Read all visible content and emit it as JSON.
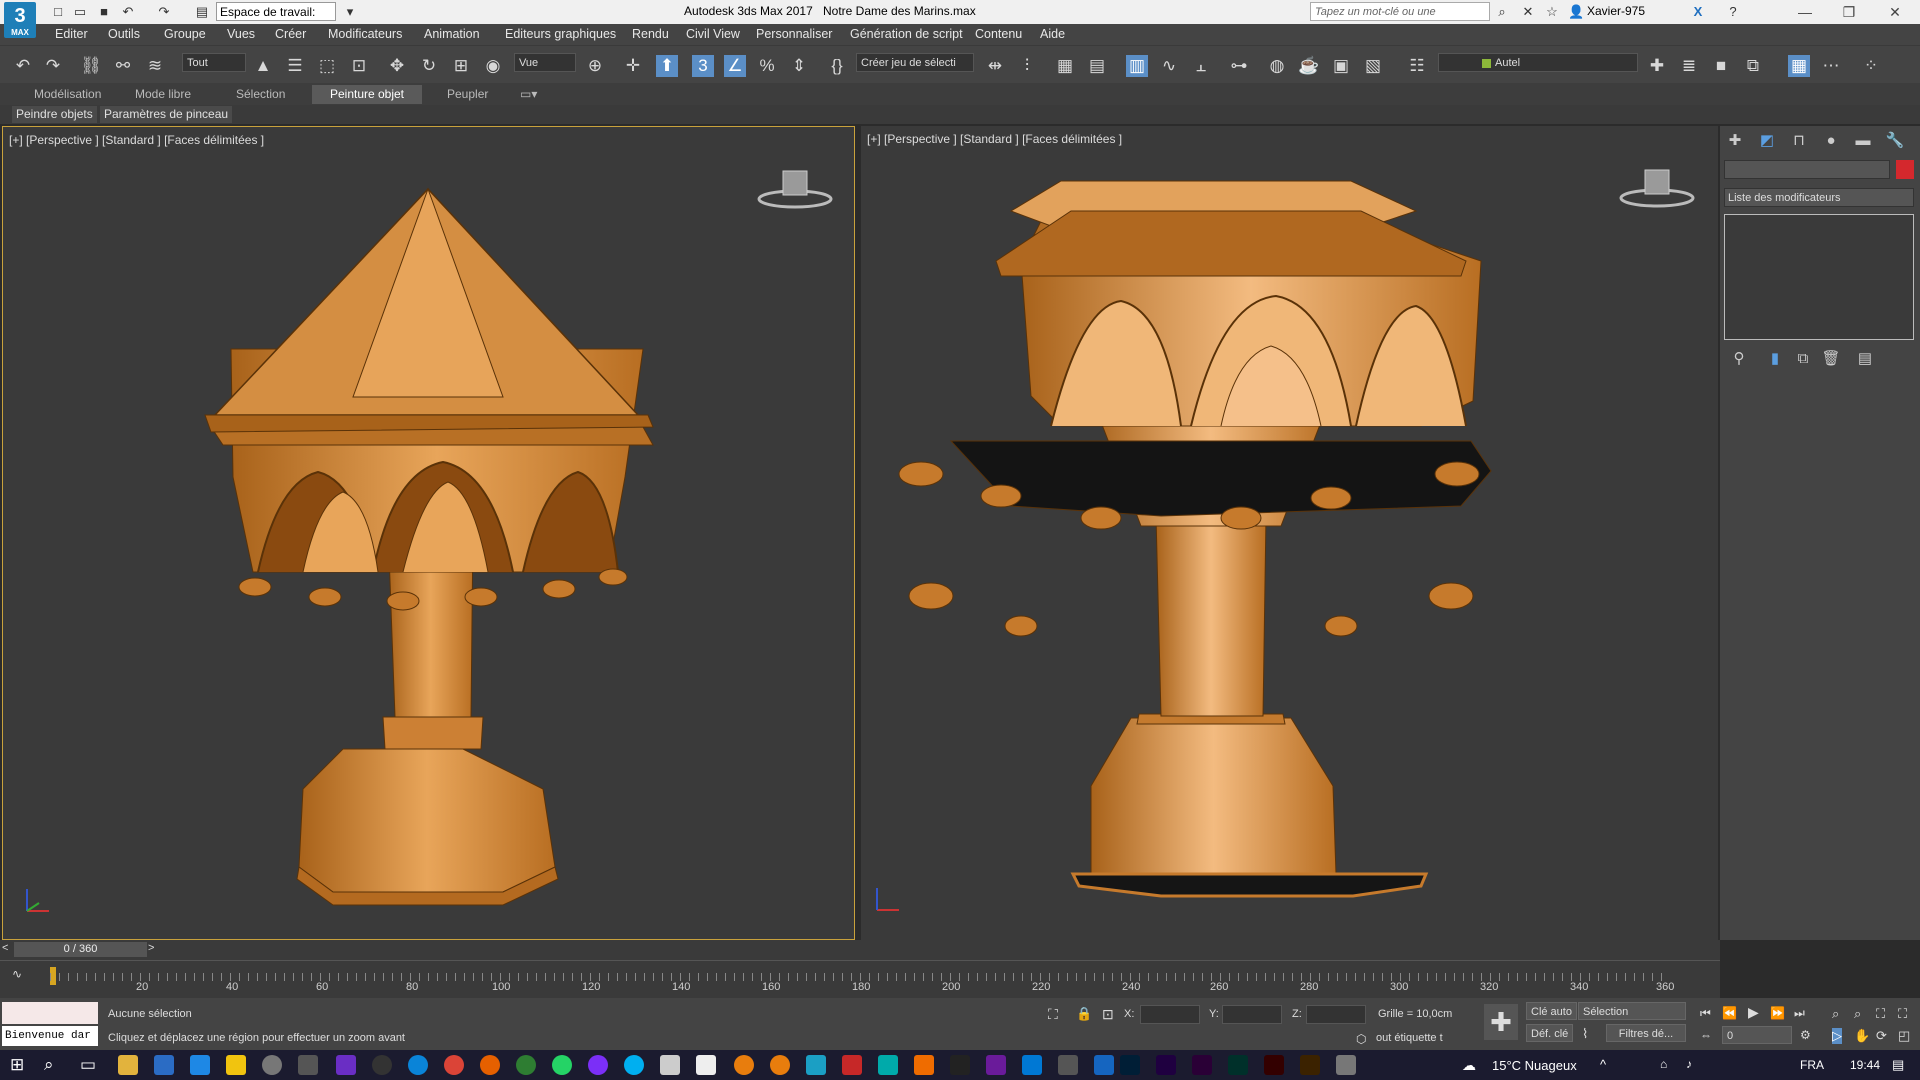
{
  "titlebar": {
    "logo_text": "3",
    "logo_sub": "MAX",
    "workspace": "Espace de travail: Par",
    "app_title": "Autodesk 3ds Max 2017",
    "doc_title": "Notre Dame des Marins.max",
    "search_placeholder": "Tapez un mot-clé ou une expression",
    "user": "Xavier-975"
  },
  "menu": [
    "Editer",
    "Outils",
    "Groupe",
    "Vues",
    "Créer",
    "Modificateurs",
    "Animation",
    "Editeurs graphiques",
    "Rendu",
    "Civil View",
    "Personnaliser",
    "Génération de script",
    "Contenu",
    "Aide"
  ],
  "toolbar": {
    "filter": "Tout",
    "ref_coord": "Vue",
    "selection_set": "Créer jeu de sélecti",
    "layer": "Autel"
  },
  "ribbon": {
    "tabs": [
      "Modélisation",
      "Mode libre",
      "Sélection",
      "Peinture objet",
      "Peupler"
    ],
    "active_tab": "Peinture objet",
    "sub": [
      "Peindre objets",
      "Paramètres de pinceau"
    ]
  },
  "viewports": [
    {
      "label": "[+] [Perspective ] [Standard ] [Faces délimitées ]"
    },
    {
      "label": "[+] [Perspective ] [Standard ] [Faces délimitées ]"
    }
  ],
  "command_panel": {
    "modifier_list": "Liste des modificateurs",
    "object_color": "#d4282d"
  },
  "timeline": {
    "frame": "0 / 360",
    "ticks": [
      "20",
      "40",
      "60",
      "80",
      "100",
      "120",
      "140",
      "160",
      "180",
      "200",
      "220",
      "240",
      "260",
      "280",
      "300",
      "320",
      "340",
      "360"
    ]
  },
  "status": {
    "selection": "Aucune sélection",
    "prompt": "Cliquez et déplacez une région pour effectuer un zoom avant",
    "maxscript": "Bienvenue dar",
    "x_label": "X:",
    "y_label": "Y:",
    "z_label": "Z:",
    "grid": "Grille = 10,0cm",
    "tag_hint": "out étiquette t",
    "auto_key": "Clé auto",
    "set_key": "Déf. clé",
    "key_mode": "Sélection",
    "key_filters": "Filtres dé...",
    "frame_input": "0"
  },
  "taskbar": {
    "weather": "15°C  Nuageux",
    "lang": "FRA",
    "time": "19:44"
  }
}
